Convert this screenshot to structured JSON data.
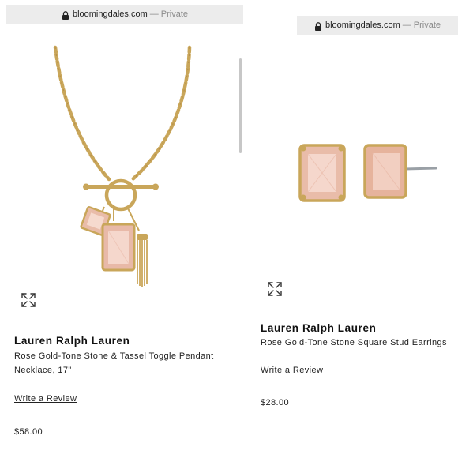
{
  "left_panel": {
    "browser": {
      "domain": "bloomingdales.com",
      "separator": "—",
      "private_label": "Private"
    },
    "product": {
      "brand": "Lauren Ralph Lauren",
      "name": "Rose Gold-Tone Stone & Tassel Toggle Pendant Necklace, 17\"",
      "review_link": "Write a Review",
      "price": "$58.00"
    }
  },
  "right_panel": {
    "browser": {
      "domain": "bloomingdales.com",
      "separator": "—",
      "private_label": "Private"
    },
    "product": {
      "brand": "Lauren Ralph Lauren",
      "name": "Rose Gold-Tone Stone Square Stud Earrings",
      "review_link": "Write a Review",
      "price": "$28.00"
    }
  },
  "icons": {
    "url_lock": "lock-icon",
    "image_expand": "expand-icon"
  },
  "colors": {
    "gold": "#c9a65a",
    "stone": "#e8b9a8",
    "url_bar": "#ececec",
    "text": "#111111"
  }
}
